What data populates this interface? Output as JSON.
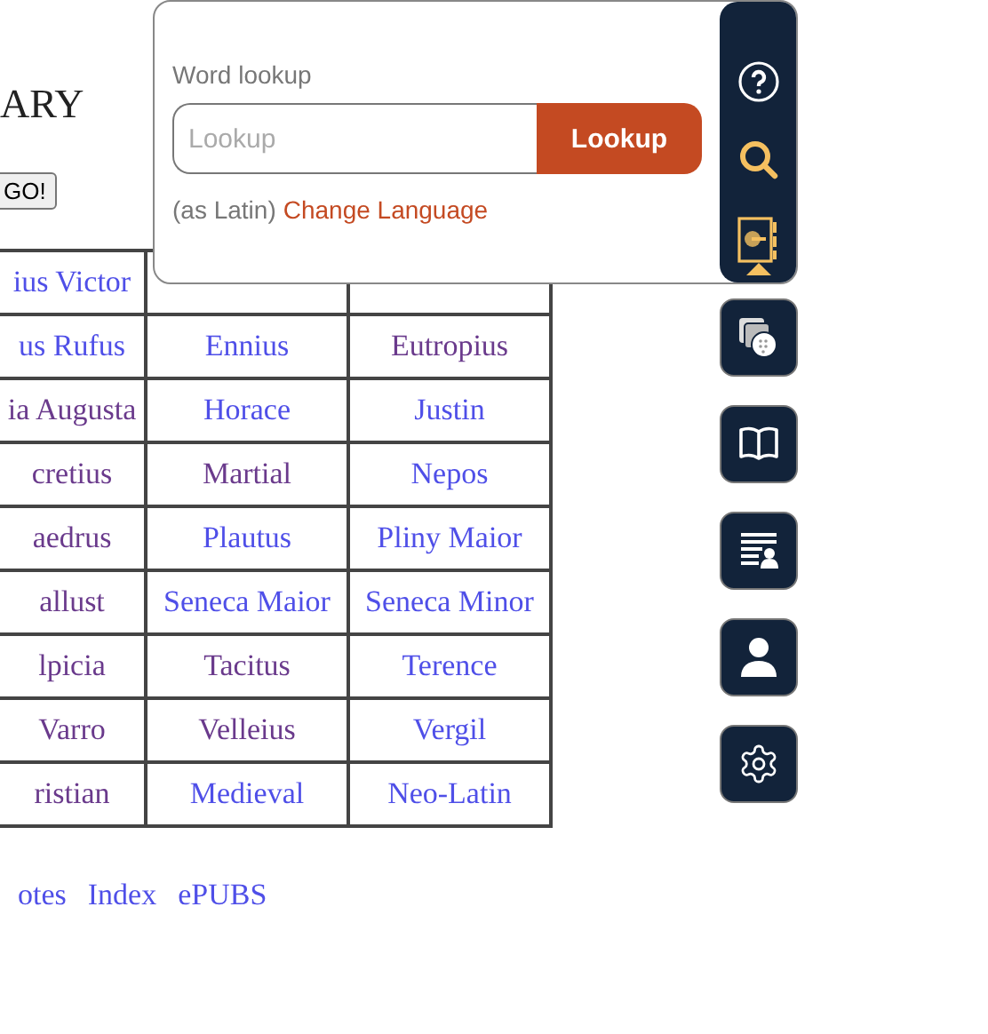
{
  "page": {
    "title": "ARY",
    "go_button": "GO!"
  },
  "table": {
    "rows": [
      [
        {
          "text": "ius Victor",
          "visited": false
        }
      ],
      [
        {
          "text": "us Rufus",
          "visited": false
        },
        {
          "text": "Ennius",
          "visited": false
        },
        {
          "text": "Eutropius",
          "visited": true
        }
      ],
      [
        {
          "text": "ia Augusta",
          "visited": true
        },
        {
          "text": "Horace",
          "visited": false
        },
        {
          "text": "Justin",
          "visited": false
        }
      ],
      [
        {
          "text": "cretius",
          "visited": true
        },
        {
          "text": "Martial",
          "visited": true
        },
        {
          "text": "Nepos",
          "visited": false
        }
      ],
      [
        {
          "text": "aedrus",
          "visited": true
        },
        {
          "text": "Plautus",
          "visited": false
        },
        {
          "text": "Pliny Maior",
          "visited": false
        }
      ],
      [
        {
          "text": "allust",
          "visited": true
        },
        {
          "text": "Seneca Maior",
          "visited": false
        },
        {
          "text": "Seneca Minor",
          "visited": false
        }
      ],
      [
        {
          "text": "lpicia",
          "visited": true
        },
        {
          "text": "Tacitus",
          "visited": true
        },
        {
          "text": "Terence",
          "visited": false
        }
      ],
      [
        {
          "text": "Varro",
          "visited": true
        },
        {
          "text": "Velleius",
          "visited": true
        },
        {
          "text": "Vergil",
          "visited": false
        }
      ],
      [
        {
          "text": "ristian",
          "visited": true
        },
        {
          "text": "Medieval",
          "visited": false
        },
        {
          "text": "Neo-Latin",
          "visited": false
        }
      ]
    ]
  },
  "footer_links": [
    "otes",
    "Index",
    "ePUBS"
  ],
  "lookup": {
    "label": "Word lookup",
    "placeholder": "Lookup",
    "button": "Lookup",
    "language_note": "(as Latin)",
    "change_language": "Change Language"
  },
  "toolbar": {
    "items": [
      {
        "kind": "help",
        "selected": false
      },
      {
        "kind": "search",
        "selected": false
      },
      {
        "kind": "vocab",
        "selected": true
      }
    ]
  },
  "tools": [
    {
      "kind": "flashcards"
    },
    {
      "kind": "book"
    },
    {
      "kind": "list"
    },
    {
      "kind": "user"
    },
    {
      "kind": "settings"
    }
  ]
}
